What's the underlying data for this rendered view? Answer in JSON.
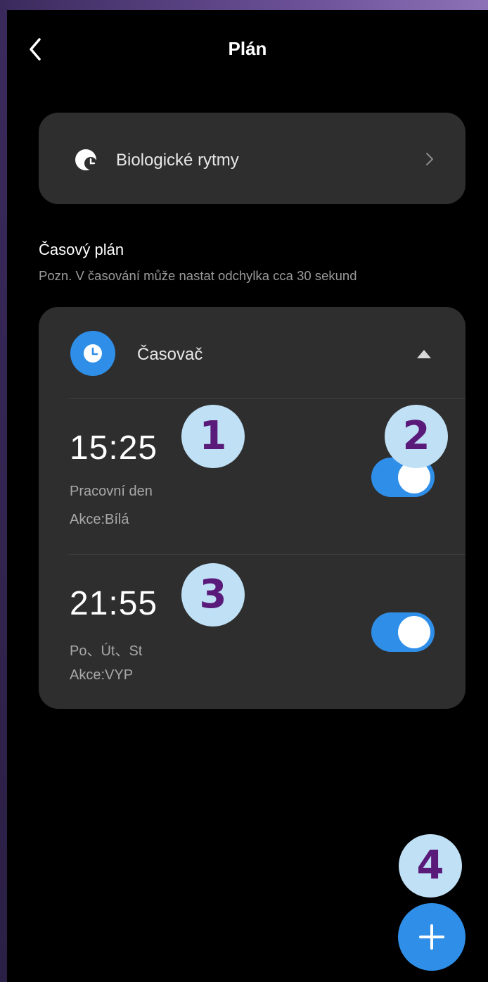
{
  "header": {
    "title": "Plán"
  },
  "bio": {
    "label": "Biologické rytmy"
  },
  "schedule": {
    "title": "Časový plán",
    "note": "Pozn. V časování může nastat odchylka cca 30 sekund"
  },
  "timer": {
    "label": "Časovač",
    "entries": [
      {
        "time": "15:25",
        "days": "Pracovní den",
        "action": "Akce:Bílá",
        "enabled": true
      },
      {
        "time": "21:55",
        "days": "Po、Út、St",
        "action": "Akce:VYP",
        "enabled": true
      }
    ]
  },
  "badges": [
    "1",
    "2",
    "3",
    "4"
  ],
  "colors": {
    "accent": "#2f8fe8",
    "card": "#2e2e2e",
    "badge_bg": "#bfe0f5",
    "badge_text": "#5a1a7a"
  }
}
